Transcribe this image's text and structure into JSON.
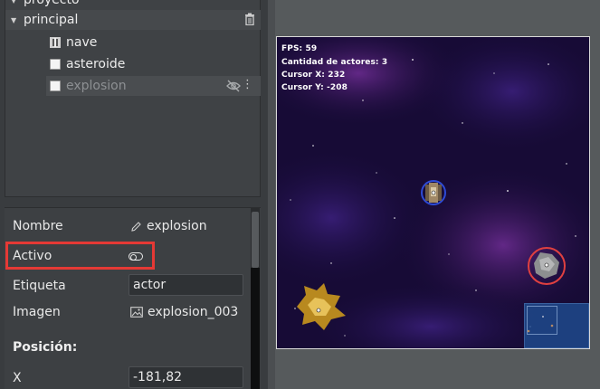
{
  "tree": {
    "project_label": "proyecto",
    "scene_label": "principal",
    "items": [
      {
        "label": "nave",
        "type": "ship"
      },
      {
        "label": "asteroide",
        "type": "checkbox"
      },
      {
        "label": "explosion",
        "type": "checkbox",
        "selected": true,
        "hidden": true
      }
    ]
  },
  "properties": {
    "name_label": "Nombre",
    "name_value": "explosion",
    "active_label": "Activo",
    "tag_label": "Etiqueta",
    "tag_value": "actor",
    "image_label": "Imagen",
    "image_value": "explosion_003",
    "position_title": "Posición:",
    "x_label": "X",
    "x_value": "-181,82"
  },
  "game": {
    "fps": "FPS: 59",
    "actors": "Cantidad de actores: 3",
    "cursor_x": "Cursor X: 232",
    "cursor_y": "Cursor Y: -208"
  },
  "colors": {
    "highlight": "#e53935",
    "selection_ring_blue": "#2e4bd6",
    "selection_ring_red": "#e04040"
  }
}
